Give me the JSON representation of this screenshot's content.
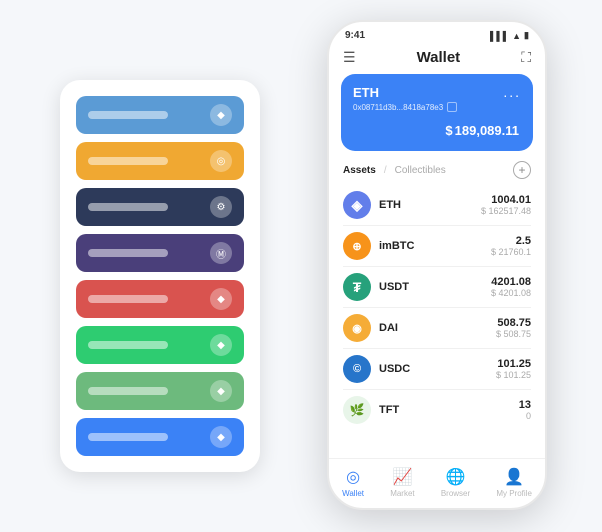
{
  "page": {
    "background": "#f5f7fa"
  },
  "leftStack": {
    "cards": [
      {
        "color": "#5b9bd5",
        "label": "",
        "icon": "◆"
      },
      {
        "color": "#f0a832",
        "label": "",
        "icon": "◎"
      },
      {
        "color": "#2d3a5a",
        "label": "",
        "icon": "⚙"
      },
      {
        "color": "#4a3f7a",
        "label": "",
        "icon": "Ⓜ"
      },
      {
        "color": "#d9534f",
        "label": "",
        "icon": "◆"
      },
      {
        "color": "#2ecc71",
        "label": "",
        "icon": "◆"
      },
      {
        "color": "#6dba7d",
        "label": "",
        "icon": "◆"
      },
      {
        "color": "#3b82f6",
        "label": "",
        "icon": "◆"
      }
    ]
  },
  "phone": {
    "statusBar": {
      "time": "9:41",
      "signal": "▌▌▌",
      "wifi": "▲",
      "battery": "▮"
    },
    "header": {
      "menuIcon": "☰",
      "title": "Wallet",
      "expandIcon": "⛶"
    },
    "ethCard": {
      "title": "ETH",
      "dotsLabel": "...",
      "address": "0x08711d3b...8418a78e3",
      "copyIcon": "⧉",
      "balancePrefix": "$",
      "balance": "189,089.11"
    },
    "assetsTabs": {
      "active": "Assets",
      "separator": "/",
      "inactive": "Collectibles"
    },
    "assetsAddIcon": "+",
    "assets": [
      {
        "name": "ETH",
        "icon": "◈",
        "iconBg": "#627eea",
        "iconColor": "white",
        "amount": "1004.01",
        "usd": "$ 162517.48"
      },
      {
        "name": "imBTC",
        "icon": "⊕",
        "iconBg": "#f7931a",
        "iconColor": "white",
        "amount": "2.5",
        "usd": "$ 21760.1"
      },
      {
        "name": "USDT",
        "icon": "₮",
        "iconBg": "#26a17b",
        "iconColor": "white",
        "amount": "4201.08",
        "usd": "$ 4201.08"
      },
      {
        "name": "DAI",
        "icon": "◉",
        "iconBg": "#f5ac37",
        "iconColor": "white",
        "amount": "508.75",
        "usd": "$ 508.75"
      },
      {
        "name": "USDC",
        "icon": "©",
        "iconBg": "#2775ca",
        "iconColor": "white",
        "amount": "101.25",
        "usd": "$ 101.25"
      },
      {
        "name": "TFT",
        "icon": "🌿",
        "iconBg": "#e8f5e9",
        "iconColor": "#4caf50",
        "amount": "13",
        "usd": "0"
      }
    ],
    "bottomNav": [
      {
        "icon": "◎",
        "label": "Wallet",
        "active": true
      },
      {
        "icon": "📈",
        "label": "Market",
        "active": false
      },
      {
        "icon": "🌐",
        "label": "Browser",
        "active": false
      },
      {
        "icon": "👤",
        "label": "My Profile",
        "active": false
      }
    ]
  }
}
